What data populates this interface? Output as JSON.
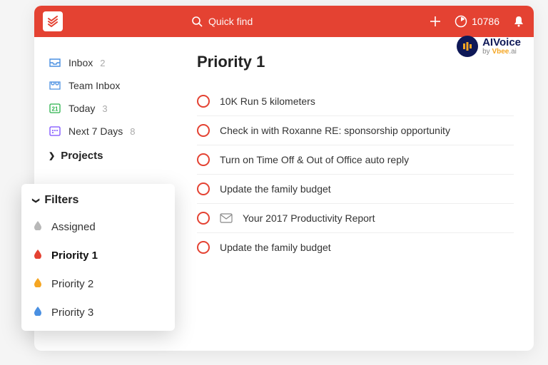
{
  "header": {
    "search_placeholder": "Quick find",
    "points": "10786"
  },
  "sidebar": {
    "items": [
      {
        "label": "Inbox",
        "count": "2"
      },
      {
        "label": "Team Inbox",
        "count": ""
      },
      {
        "label": "Today",
        "count": "3"
      },
      {
        "label": "Next 7 Days",
        "count": "8"
      }
    ],
    "projects_label": "Projects"
  },
  "filters": {
    "title": "Filters",
    "items": [
      {
        "label": "Assigned",
        "color": "#b8b8b8"
      },
      {
        "label": "Priority 1",
        "color": "#e44232"
      },
      {
        "label": "Priority 2",
        "color": "#f5a623"
      },
      {
        "label": "Priority 3",
        "color": "#4a90e2"
      }
    ]
  },
  "main": {
    "title": "Priority 1",
    "tasks": [
      {
        "title": "10K Run 5 kilometers",
        "has_icon": false
      },
      {
        "title": "Check in with Roxanne RE: sponsorship opportunity",
        "has_icon": false
      },
      {
        "title": "Turn on Time Off & Out of Office auto reply",
        "has_icon": false
      },
      {
        "title": "Update the family budget",
        "has_icon": false
      },
      {
        "title": "Your 2017 Productivity Report",
        "has_icon": true
      },
      {
        "title": "Update the family budget",
        "has_icon": false
      }
    ]
  },
  "brand": {
    "name": "AIVoice",
    "sub_pre": "by ",
    "sub_brand": "Vbee",
    "sub_post": ".ai"
  },
  "colors": {
    "accent": "#e44232",
    "inbox": "#4a90e2",
    "team": "#4a90e2",
    "today": "#2bb24c",
    "next7": "#7b4dff"
  }
}
